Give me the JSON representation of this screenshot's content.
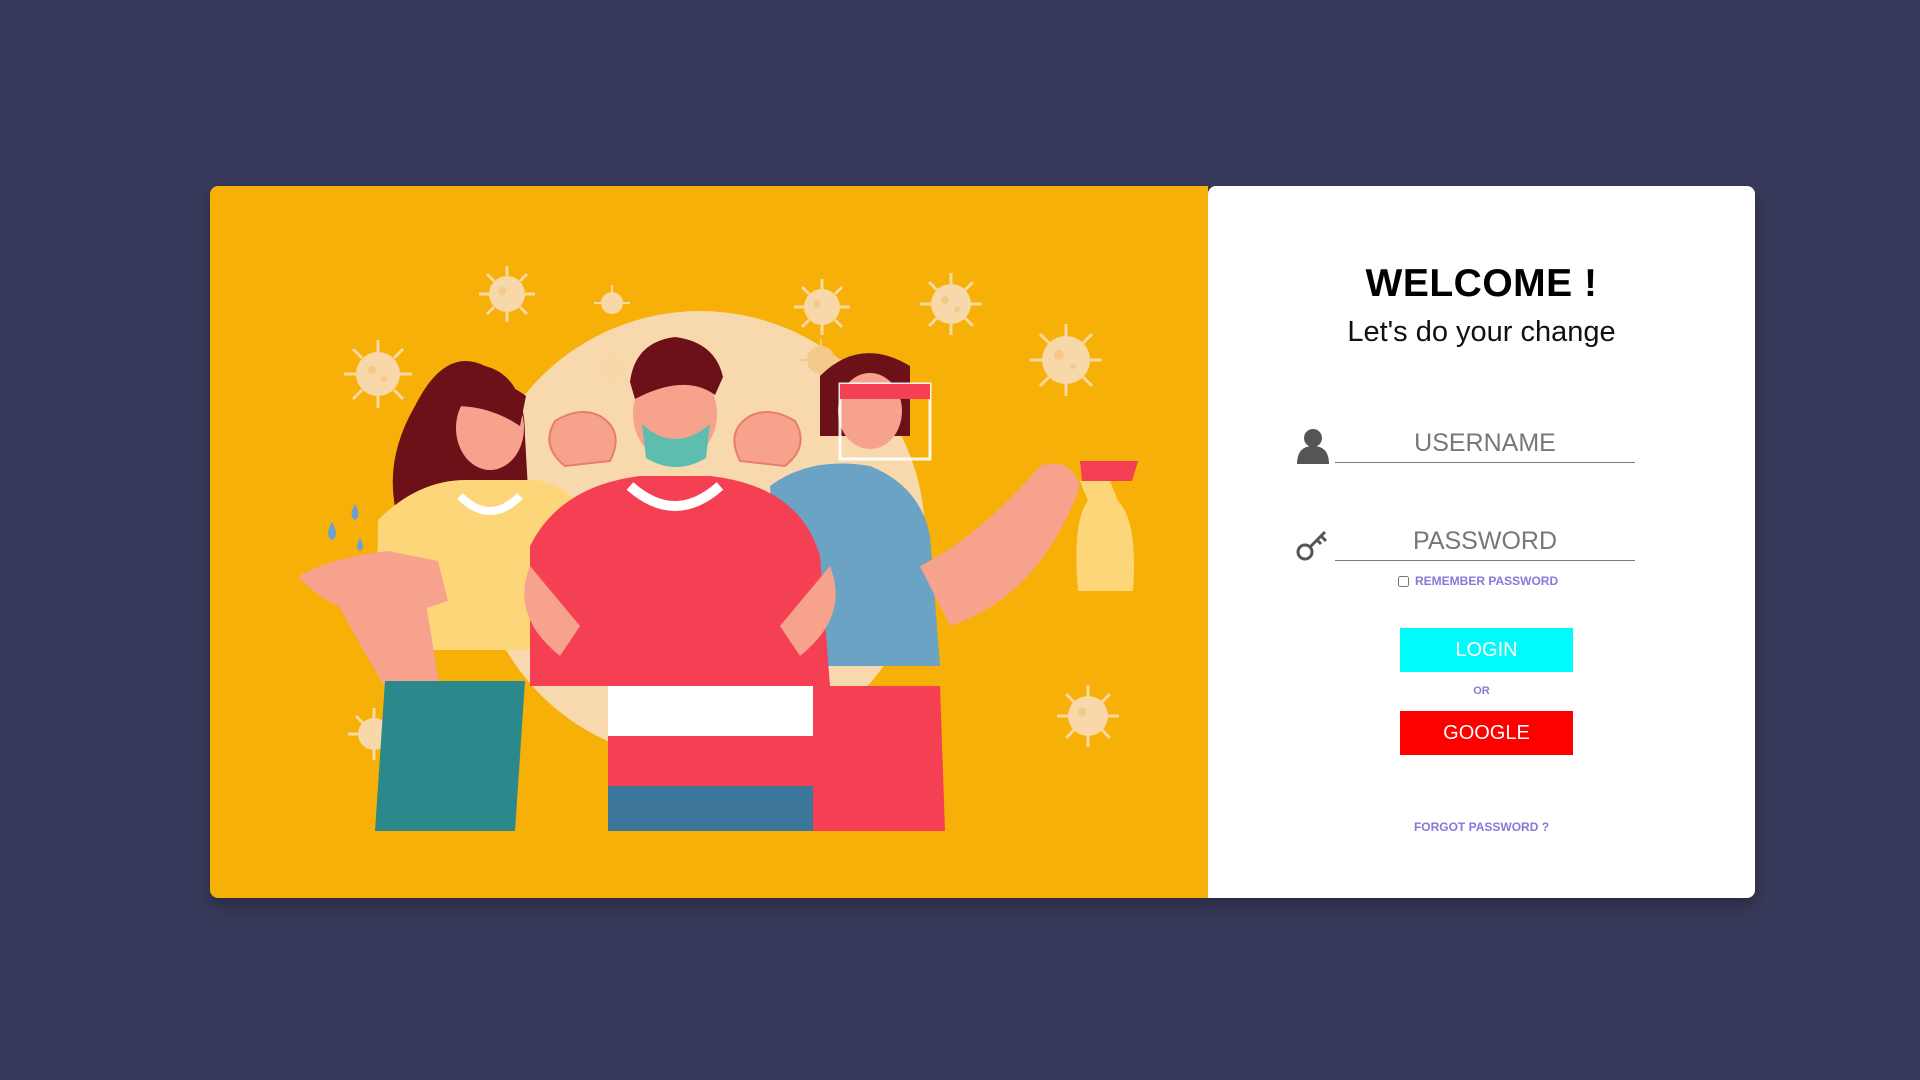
{
  "welcome": {
    "title": "WELCOME !",
    "subtitle": "Let's do your change"
  },
  "form": {
    "username_placeholder": "USERNAME",
    "password_placeholder": "PASSWORD",
    "remember_label": "REMEMBER PASSWORD",
    "login_label": "LOGIN",
    "or_label": "OR",
    "google_label": "GOOGLE",
    "forgot_label": "FORGOT PASSWORD ?"
  },
  "icons": {
    "username": "user-icon",
    "password": "key-icon"
  },
  "colors": {
    "background": "#383a5b",
    "illustration_panel": "#f6b007",
    "login_button": "#00fbfb",
    "google_button": "#fd0000",
    "link_text": "#8b77d8"
  }
}
